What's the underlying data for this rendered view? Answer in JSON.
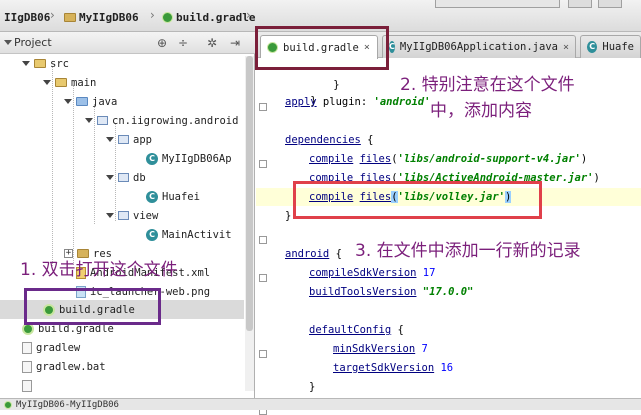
{
  "breadcrumb": {
    "project_partial": "IIgDB06",
    "project": "MyIIgDB06",
    "file": "build.gradle"
  },
  "project_panel": {
    "title": "Project",
    "items": {
      "src": "src",
      "main": "main",
      "java": "java",
      "package": "cn.iigrowing.android",
      "app": "app",
      "app_class": "MyIIgDB06Ap",
      "db": "db",
      "db_class": "Huafei",
      "view": "view",
      "view_class": "MainActivit",
      "res": "res",
      "manifest": "AndroidManifest.xml",
      "launcher": "ic_launcher-web.png",
      "build_inner": "build.gradle",
      "build_outer": "build.gradle",
      "gradlew": "gradlew",
      "gradlew_bat": "gradlew.bat"
    }
  },
  "editor": {
    "tabs": [
      {
        "label": "build.gradle"
      },
      {
        "label": "MyIIgDB06Application.java"
      },
      {
        "label": "Huafe"
      }
    ],
    "close_glyph": "×"
  },
  "code": {
    "l1_brace": "}",
    "l2_kw": "apply",
    "l2_mid": " plugin: ",
    "l2_str": "'android'",
    "l3_kw": "dependencies",
    "l3_end": " {",
    "compile_kw": "compile",
    "files_kw": "files",
    "dep1": "'libs/android-support-v4.jar'",
    "dep2": "'libs/ActiveAndroid-master.jar'",
    "dep3": "'libs/volley.jar'",
    "open_paren": "(",
    "close_paren": ")",
    "l7_brace": "}",
    "l8_kw": "android",
    "l8_end": " {",
    "csv_kw": "compileSdkVersion",
    "csv_val": " 17",
    "btv_kw": "buildToolsVersion",
    "btv_val": "\"17.0.0\"",
    "dc_kw": "defaultConfig",
    "dc_end": " {",
    "min_kw": "minSdkVersion",
    "min_val": " 7",
    "tgt_kw": "targetSdkVersion",
    "tgt_val": " 16",
    "inner_close": "}"
  },
  "annotations": {
    "a1": "1. 双击打开这个文件",
    "a2_line1": "2. 特别注意在这个文件",
    "a2_line2": "中，添加内容",
    "a3": "3. 在文件中添加一行新的记录"
  },
  "status": {
    "text": "MyIIgDB06-MyIIgDB06"
  },
  "colors": {
    "annotation": "#7b1f7b",
    "box_tab": "#7b1f3a",
    "box_line": "#e0404a",
    "box_tree": "#6a2a8a"
  }
}
